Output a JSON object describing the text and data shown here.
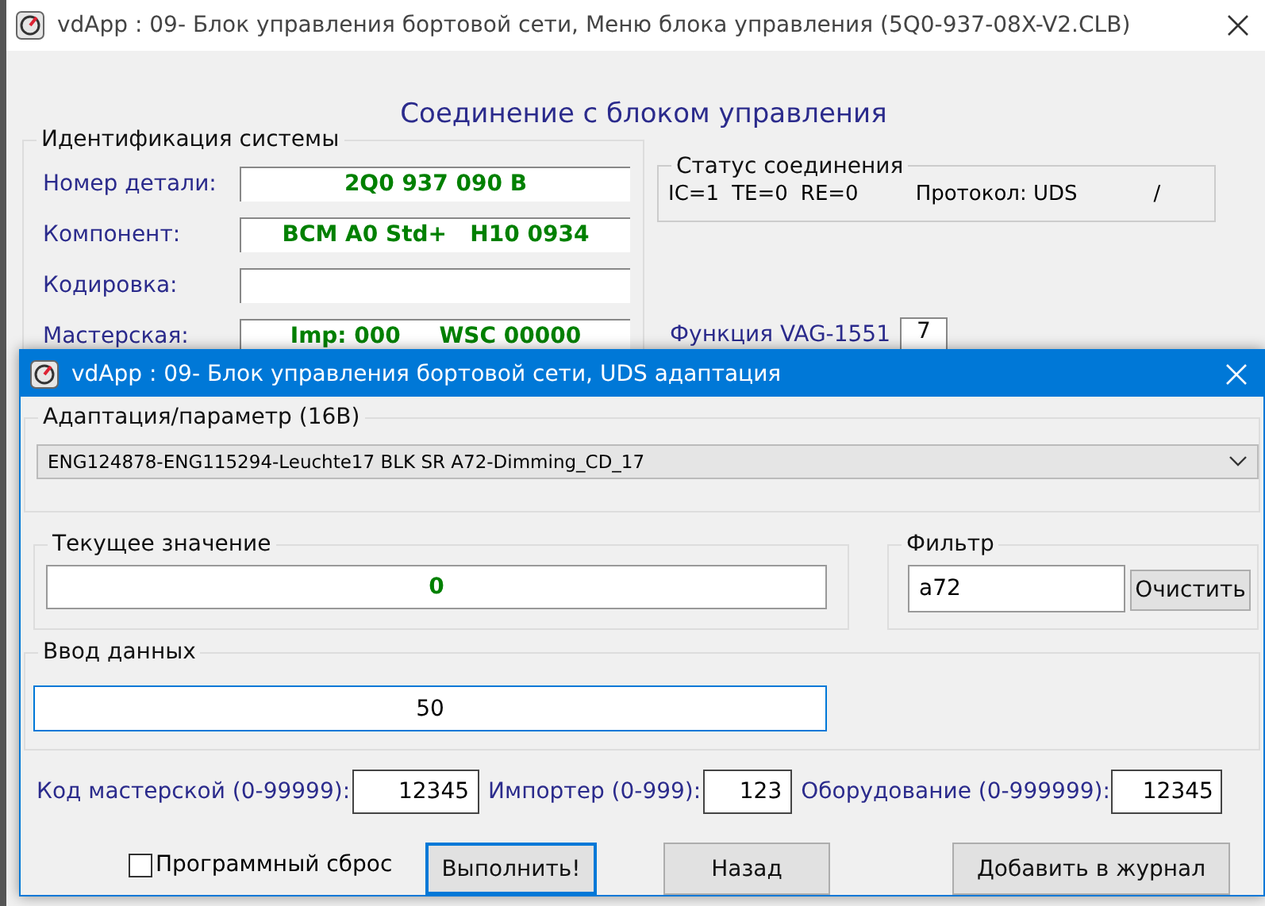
{
  "main_window": {
    "title": "vdApp : 09- Блок управления бортовой сети,  Меню блока управления (5Q0-937-08X-V2.CLB)",
    "heading": "Соединение с блоком управления",
    "identification": {
      "title": "Идентификация системы",
      "rows": [
        {
          "label": "Номер детали:",
          "value": "2Q0 937 090 B"
        },
        {
          "label": "Компонент:",
          "value": "BCM A0 Std+   H10 0934"
        },
        {
          "label": "Кодировка:",
          "value": ""
        },
        {
          "label": "Мастерская:",
          "value": "Imp: 000     WSC 00000"
        }
      ]
    },
    "status": {
      "title": "Статус соединения",
      "ic": "IC=1",
      "te": "TE=0",
      "re": "RE=0",
      "protocol": "Протокол: UDS",
      "indicator": "/"
    },
    "vag_function": {
      "label": "Функция VAG-1551",
      "value": "7"
    }
  },
  "dialog": {
    "title": "vdApp : 09- Блок управления бортовой сети,  UDS адаптация",
    "adaptation": {
      "title": "Адаптация/параметр (16B)",
      "selected_value": "ENG124878-ENG115294-Leuchte17 BLK SR A72-Dimming_CD_17"
    },
    "current_value": {
      "title": "Текущее значение",
      "value": "0"
    },
    "filter": {
      "title": "Фильтр",
      "value": "a72",
      "clear_button": "Очистить"
    },
    "data_input": {
      "title": "Ввод данных",
      "value": "50"
    },
    "codes": [
      {
        "label": "Код мастерской (0-99999):",
        "value": "12345"
      },
      {
        "label": "Импортер (0-999):",
        "value": "123"
      },
      {
        "label": "Оборудование (0-999999):",
        "value": "12345"
      }
    ],
    "software_reset": {
      "label": "Программный сброс",
      "checked": false
    },
    "buttons": [
      {
        "label": "Выполнить!",
        "focused": true
      },
      {
        "label": "Назад",
        "focused": false
      },
      {
        "label": "Добавить в журнал",
        "focused": false
      }
    ]
  }
}
